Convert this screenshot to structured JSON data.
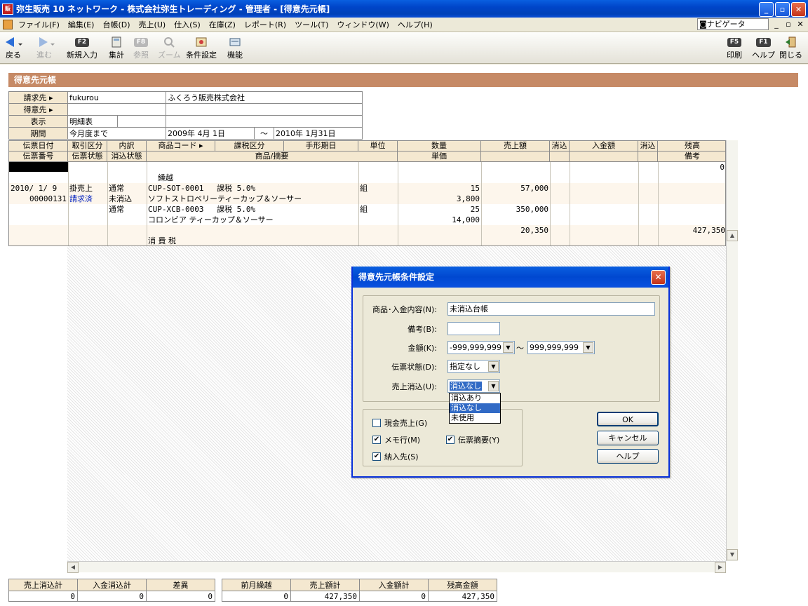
{
  "window": {
    "title": "弥生販売 10 ネットワーク - 株式会社弥生トレーディング - 管理者 - [得意先元帳]",
    "app_icon": "販",
    "btn_min": "_",
    "btn_max": "▫",
    "btn_close": "✕"
  },
  "menu": {
    "items": [
      "ファイル(F)",
      "編集(E)",
      "台帳(D)",
      "売上(U)",
      "仕入(S)",
      "在庫(Z)",
      "レポート(R)",
      "ツール(T)",
      "ウィンドウ(W)",
      "ヘルプ(H)"
    ],
    "navigator": "ナビゲータ",
    "mdi_min": "_",
    "mdi_restore": "▫",
    "mdi_close": "✕"
  },
  "toolbar": {
    "back": "戻る",
    "forward": "進む",
    "new_entry": "新規入力",
    "new_key": "F2",
    "total": "集計",
    "reference": "参照",
    "ref_key": "F8",
    "zoom": "ズーム",
    "conditions": "条件設定",
    "functions": "機能",
    "print": "印刷",
    "print_key": "F5",
    "help": "ヘルプ",
    "help_key": "F1",
    "close": "閉じる"
  },
  "section": {
    "title": "得意先元帳"
  },
  "info": {
    "billing_label": "請求先",
    "billing_code": "fukurou",
    "billing_name": "ふくろう販売株式会社",
    "customer_label": "得意先",
    "display_label": "表示",
    "display_value": "明細表",
    "period_label": "期間",
    "period_value": "今月度まで",
    "period_from": "2009年 4月 1日",
    "period_sep": "～",
    "period_to": "2010年 1月31日"
  },
  "grid_headers": {
    "row1": [
      "伝票日付",
      "取引区分",
      "内訳",
      "商品コード ▸",
      "課税区分",
      "手形期日",
      "単位",
      "数量",
      "売上額",
      "消込",
      "入金額",
      "消込",
      "残高"
    ],
    "row2": [
      "伝票番号",
      "伝票状態",
      "消込状態",
      "商品/摘要",
      "単価",
      "備考"
    ]
  },
  "grid": {
    "carry_balance": "0",
    "carry_label": "繰越",
    "date": "2010/ 1/ 9",
    "slip_no": "00000131",
    "trade_type": "掛売上",
    "slip_state": "請求済",
    "breakdown1": "通常",
    "clear_state": "未消込",
    "breakdown2": "通常",
    "item1_code": "CUP-SOT-0001",
    "item1_tax": "課税 5.0%",
    "item1_unit": "組",
    "item1_qty": "15",
    "item1_amount": "57,000",
    "item1_name": "ソフトストロベリーティーカップ＆ソーサー",
    "item1_price": "3,800",
    "item2_code": "CUP-XCB-0003",
    "item2_tax": "課税 5.0%",
    "item2_unit": "組",
    "item2_qty": "25",
    "item2_amount": "350,000",
    "item2_name": "コロンビア ティーカップ＆ソーサー",
    "item2_price": "14,000",
    "tax_amount": "20,350",
    "balance": "427,350",
    "tax_label": "消 費 税"
  },
  "totals": {
    "left_headers": [
      "売上消込計",
      "入金消込計",
      "差異"
    ],
    "left_values": [
      "0",
      "0",
      "0"
    ],
    "right_headers": [
      "前月繰越",
      "売上額計",
      "入金額計",
      "残高金額"
    ],
    "right_values": [
      "0",
      "427,350",
      "0",
      "427,350"
    ]
  },
  "dialog": {
    "title": "得意先元帳条件設定",
    "content_label": "商品･入金内容(N):",
    "content_value": "未消込台帳",
    "memo_label": "備考(B):",
    "memo_value": "",
    "amount_label": "金額(K):",
    "amount_from": "-999,999,999",
    "amount_sep": "～",
    "amount_to": "999,999,999",
    "slip_state_label": "伝票状態(D):",
    "slip_state_value": "指定なし",
    "sales_clear_label": "売上消込(U):",
    "sales_clear_value": "消込なし",
    "dropdown_options": [
      "消込あり",
      "消込なし",
      "未使用"
    ],
    "cash_sales": "現金売上(G)",
    "memo_line": "メモ行(M)",
    "slip_summary": "伝票摘要(Y)",
    "delivery": "納入先(S)",
    "ok": "OK",
    "cancel": "キャンセル",
    "help": "ヘルプ",
    "check": "✔"
  }
}
